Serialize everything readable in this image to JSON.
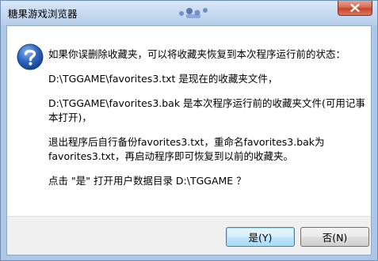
{
  "window": {
    "title": "糖果游戏浏览器"
  },
  "dialog": {
    "icon": "question-icon",
    "lines": [
      "如果你误删除收藏夹，可以将收藏夹恢复到本次程序运行前的状态：",
      "D:\\TGGAME\\favorites3.txt 是现在的收藏夹文件，",
      "D:\\TGGAME\\favorites3.bak 是本次程序运行前的收藏夹文件(可用记事本打开)，",
      "退出程序后自行备份favorites3.txt，重命名favorites3.bak为favorites3.txt，再启动程序即可恢复到以前的收藏夹。",
      "点击 \"是\" 打开用户数据目录 D:\\TGGAME ？"
    ]
  },
  "buttons": {
    "yes_label": "是(Y)",
    "no_label": "否(N)"
  },
  "colors": {
    "title_bar": "#c5d9f1",
    "close_button": "#c7432a",
    "footer": "#f0f0f0",
    "default_button_border": "#3c7fb1"
  }
}
